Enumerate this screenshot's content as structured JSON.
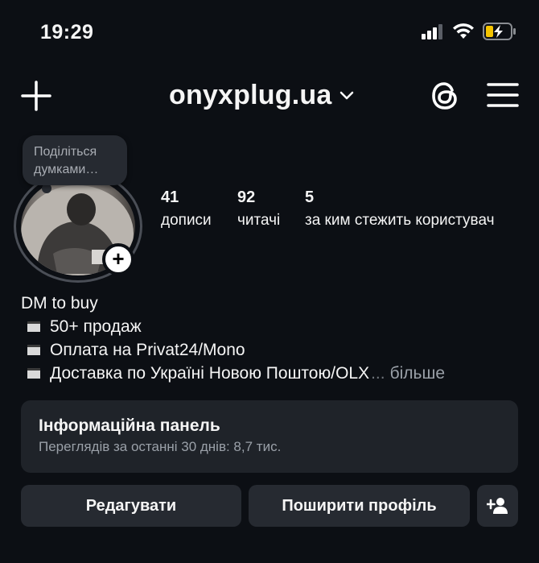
{
  "status_bar": {
    "time": "19:29"
  },
  "header": {
    "username": "onyxplug.ua"
  },
  "note": {
    "text": "Поділіться думками…"
  },
  "stats": [
    {
      "value": "41",
      "label": "дописи"
    },
    {
      "value": "92",
      "label": "читачі"
    },
    {
      "value": "5",
      "label": "за ким стежить користувач"
    }
  ],
  "bio": {
    "line1": "DM to buy",
    "items": [
      "50+ продаж",
      "Оплата на Privat24/Mono",
      "Доставка по Україні Новою Поштою/OLX"
    ],
    "ellipsis": "...",
    "more": "більше"
  },
  "dashboard": {
    "title": "Інформаційна панель",
    "subtitle": "Переглядів за останні 30 днів: 8,7 тис."
  },
  "buttons": {
    "edit": "Редагувати",
    "share": "Поширити профіль"
  }
}
